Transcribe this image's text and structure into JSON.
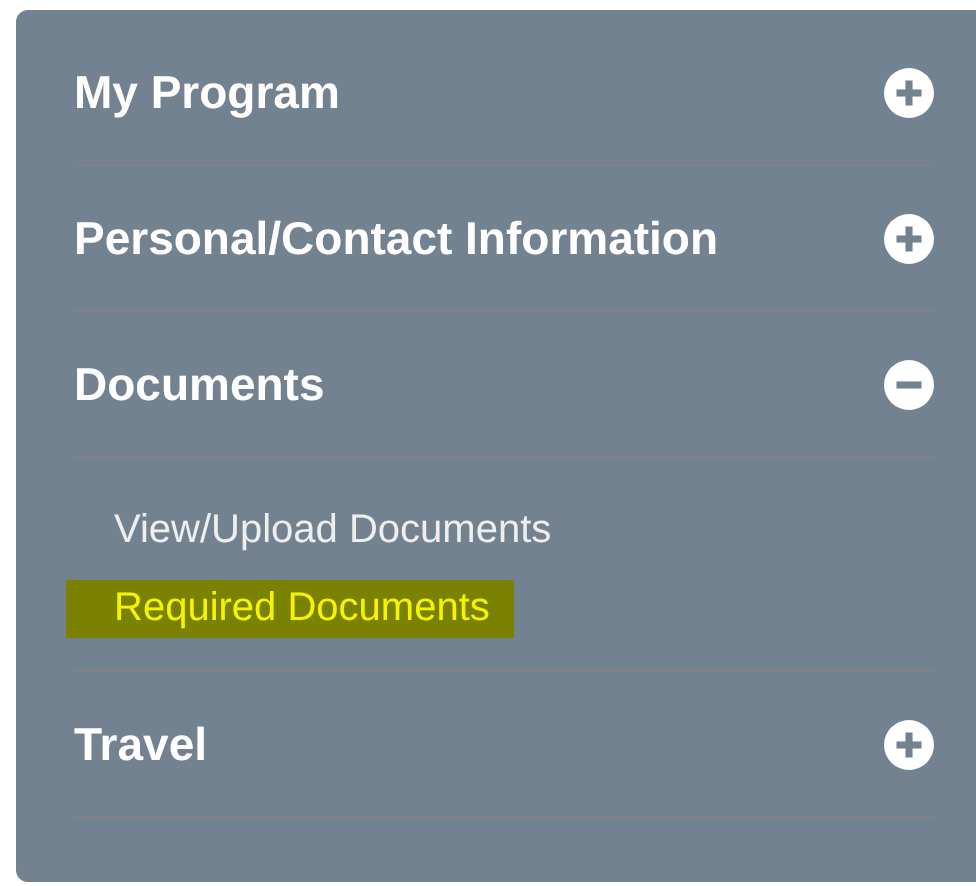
{
  "sections": [
    {
      "title": "My Program",
      "expanded": false
    },
    {
      "title": "Personal/Contact Information",
      "expanded": false
    },
    {
      "title": "Documents",
      "expanded": true,
      "items": [
        {
          "label": "View/Upload Documents",
          "highlighted": false
        },
        {
          "label": "Required Documents",
          "highlighted": true
        }
      ]
    },
    {
      "title": "Travel",
      "expanded": false
    }
  ]
}
